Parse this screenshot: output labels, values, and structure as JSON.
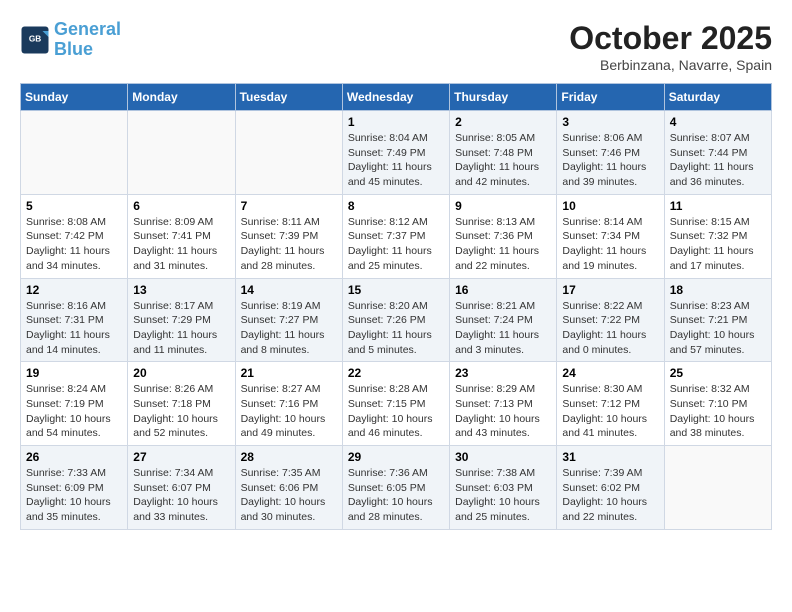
{
  "header": {
    "logo_line1": "General",
    "logo_line2": "Blue",
    "month": "October 2025",
    "location": "Berbinzana, Navarre, Spain"
  },
  "weekdays": [
    "Sunday",
    "Monday",
    "Tuesday",
    "Wednesday",
    "Thursday",
    "Friday",
    "Saturday"
  ],
  "weeks": [
    [
      {
        "day": "",
        "info": ""
      },
      {
        "day": "",
        "info": ""
      },
      {
        "day": "",
        "info": ""
      },
      {
        "day": "1",
        "info": "Sunrise: 8:04 AM\nSunset: 7:49 PM\nDaylight: 11 hours\nand 45 minutes."
      },
      {
        "day": "2",
        "info": "Sunrise: 8:05 AM\nSunset: 7:48 PM\nDaylight: 11 hours\nand 42 minutes."
      },
      {
        "day": "3",
        "info": "Sunrise: 8:06 AM\nSunset: 7:46 PM\nDaylight: 11 hours\nand 39 minutes."
      },
      {
        "day": "4",
        "info": "Sunrise: 8:07 AM\nSunset: 7:44 PM\nDaylight: 11 hours\nand 36 minutes."
      }
    ],
    [
      {
        "day": "5",
        "info": "Sunrise: 8:08 AM\nSunset: 7:42 PM\nDaylight: 11 hours\nand 34 minutes."
      },
      {
        "day": "6",
        "info": "Sunrise: 8:09 AM\nSunset: 7:41 PM\nDaylight: 11 hours\nand 31 minutes."
      },
      {
        "day": "7",
        "info": "Sunrise: 8:11 AM\nSunset: 7:39 PM\nDaylight: 11 hours\nand 28 minutes."
      },
      {
        "day": "8",
        "info": "Sunrise: 8:12 AM\nSunset: 7:37 PM\nDaylight: 11 hours\nand 25 minutes."
      },
      {
        "day": "9",
        "info": "Sunrise: 8:13 AM\nSunset: 7:36 PM\nDaylight: 11 hours\nand 22 minutes."
      },
      {
        "day": "10",
        "info": "Sunrise: 8:14 AM\nSunset: 7:34 PM\nDaylight: 11 hours\nand 19 minutes."
      },
      {
        "day": "11",
        "info": "Sunrise: 8:15 AM\nSunset: 7:32 PM\nDaylight: 11 hours\nand 17 minutes."
      }
    ],
    [
      {
        "day": "12",
        "info": "Sunrise: 8:16 AM\nSunset: 7:31 PM\nDaylight: 11 hours\nand 14 minutes."
      },
      {
        "day": "13",
        "info": "Sunrise: 8:17 AM\nSunset: 7:29 PM\nDaylight: 11 hours\nand 11 minutes."
      },
      {
        "day": "14",
        "info": "Sunrise: 8:19 AM\nSunset: 7:27 PM\nDaylight: 11 hours\nand 8 minutes."
      },
      {
        "day": "15",
        "info": "Sunrise: 8:20 AM\nSunset: 7:26 PM\nDaylight: 11 hours\nand 5 minutes."
      },
      {
        "day": "16",
        "info": "Sunrise: 8:21 AM\nSunset: 7:24 PM\nDaylight: 11 hours\nand 3 minutes."
      },
      {
        "day": "17",
        "info": "Sunrise: 8:22 AM\nSunset: 7:22 PM\nDaylight: 11 hours\nand 0 minutes."
      },
      {
        "day": "18",
        "info": "Sunrise: 8:23 AM\nSunset: 7:21 PM\nDaylight: 10 hours\nand 57 minutes."
      }
    ],
    [
      {
        "day": "19",
        "info": "Sunrise: 8:24 AM\nSunset: 7:19 PM\nDaylight: 10 hours\nand 54 minutes."
      },
      {
        "day": "20",
        "info": "Sunrise: 8:26 AM\nSunset: 7:18 PM\nDaylight: 10 hours\nand 52 minutes."
      },
      {
        "day": "21",
        "info": "Sunrise: 8:27 AM\nSunset: 7:16 PM\nDaylight: 10 hours\nand 49 minutes."
      },
      {
        "day": "22",
        "info": "Sunrise: 8:28 AM\nSunset: 7:15 PM\nDaylight: 10 hours\nand 46 minutes."
      },
      {
        "day": "23",
        "info": "Sunrise: 8:29 AM\nSunset: 7:13 PM\nDaylight: 10 hours\nand 43 minutes."
      },
      {
        "day": "24",
        "info": "Sunrise: 8:30 AM\nSunset: 7:12 PM\nDaylight: 10 hours\nand 41 minutes."
      },
      {
        "day": "25",
        "info": "Sunrise: 8:32 AM\nSunset: 7:10 PM\nDaylight: 10 hours\nand 38 minutes."
      }
    ],
    [
      {
        "day": "26",
        "info": "Sunrise: 7:33 AM\nSunset: 6:09 PM\nDaylight: 10 hours\nand 35 minutes."
      },
      {
        "day": "27",
        "info": "Sunrise: 7:34 AM\nSunset: 6:07 PM\nDaylight: 10 hours\nand 33 minutes."
      },
      {
        "day": "28",
        "info": "Sunrise: 7:35 AM\nSunset: 6:06 PM\nDaylight: 10 hours\nand 30 minutes."
      },
      {
        "day": "29",
        "info": "Sunrise: 7:36 AM\nSunset: 6:05 PM\nDaylight: 10 hours\nand 28 minutes."
      },
      {
        "day": "30",
        "info": "Sunrise: 7:38 AM\nSunset: 6:03 PM\nDaylight: 10 hours\nand 25 minutes."
      },
      {
        "day": "31",
        "info": "Sunrise: 7:39 AM\nSunset: 6:02 PM\nDaylight: 10 hours\nand 22 minutes."
      },
      {
        "day": "",
        "info": ""
      }
    ]
  ]
}
